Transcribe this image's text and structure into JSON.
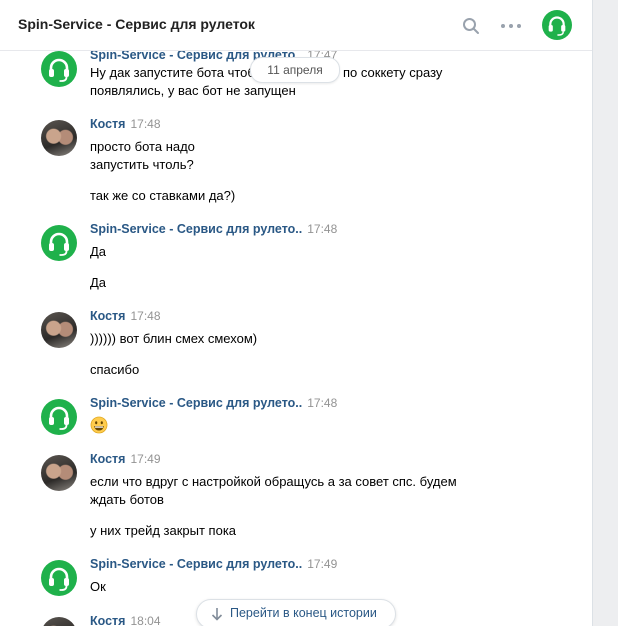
{
  "header": {
    "title": "Spin-Service - Сервис для рулеток",
    "search_icon": "search-icon",
    "more_icon": "more-dots-icon",
    "avatar_icon": "headset-icon"
  },
  "date_divider": "11 апреля",
  "jump_button": {
    "label": "Перейти в конец истории",
    "icon": "arrow-down-icon"
  },
  "messages": [
    {
      "author": "Spin-Service - Сервис для рулето..",
      "time": "17:47",
      "lines": [
        "Ну дак запустите бота чтоб",
        "по соккету сразу",
        "появлялись, у вас бот не запущен"
      ]
    },
    {
      "author": "Костя",
      "time": "17:48",
      "lines": [
        "просто бота надо",
        "запустить чтоль?",
        "так же со ставками да?)"
      ]
    },
    {
      "author": "Spin-Service - Сервис для рулето..",
      "time": "17:48",
      "lines": [
        "Да",
        "Да"
      ]
    },
    {
      "author": "Костя",
      "time": "17:48",
      "lines": [
        ")))))) вот блин смех смехом)",
        "спасибо"
      ]
    },
    {
      "author": "Spin-Service - Сервис для рулето..",
      "time": "17:48",
      "emoji": "grinning-face-emoji"
    },
    {
      "author": "Костя",
      "time": "17:49",
      "lines": [
        "если что вдруг с настройкой обращусь а за совет спс. будем",
        "ждать ботов",
        "у них трейд закрыт пока"
      ]
    },
    {
      "author": "Spin-Service - Сервис для рулето..",
      "time": "17:49",
      "lines": [
        "Ок"
      ]
    },
    {
      "author": "Костя",
      "time": "18:04"
    }
  ],
  "colors": {
    "brand_green": "#1fb14b",
    "author_link": "#2a5885",
    "timestamp": "#939393"
  }
}
